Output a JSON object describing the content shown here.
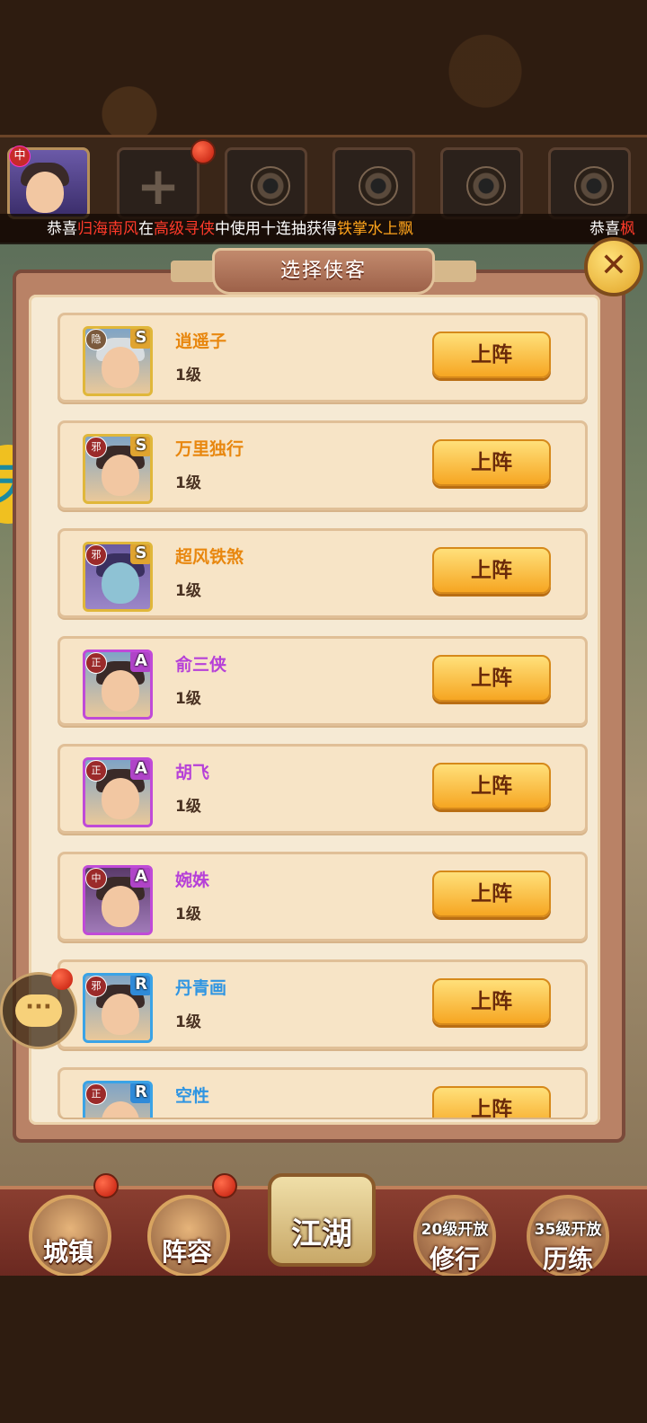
{
  "marquee": {
    "part1": "恭喜",
    "player": "归海南风",
    "part2": "在",
    "mode": "高级寻侠",
    "part3": "中使用十连抽获得",
    "item": "铁掌水上飘",
    "next_part1": "恭喜",
    "next_player": "枫"
  },
  "lineup": {
    "hero_faction": "中",
    "add_symbol": "+"
  },
  "side_badge": "天",
  "panel": {
    "title": "选择侠客",
    "close_symbol": "✕"
  },
  "heroes": [
    {
      "faction": "隐",
      "rank": "S",
      "name": "逍遥子",
      "level": "1级",
      "action": "上阵"
    },
    {
      "faction": "邪",
      "rank": "S",
      "name": "万里独行",
      "level": "1级",
      "action": "上阵"
    },
    {
      "faction": "邪",
      "rank": "S",
      "name": "超风铁煞",
      "level": "1级",
      "action": "上阵"
    },
    {
      "faction": "正",
      "rank": "A",
      "name": "俞三侠",
      "level": "1级",
      "action": "上阵"
    },
    {
      "faction": "正",
      "rank": "A",
      "name": "胡飞",
      "level": "1级",
      "action": "上阵"
    },
    {
      "faction": "中",
      "rank": "A",
      "name": "婉姝",
      "level": "1级",
      "action": "上阵"
    },
    {
      "faction": "邪",
      "rank": "R",
      "name": "丹青画",
      "level": "1级",
      "action": "上阵"
    },
    {
      "faction": "正",
      "rank": "R",
      "name": "空性",
      "level": "",
      "action": "上阵"
    }
  ],
  "chat": {
    "symbol": "···"
  },
  "nav": {
    "town": "城镇",
    "lineup": "阵容",
    "jianghu": "江湖",
    "cultivate_lock": "20级开放",
    "cultivate": "修行",
    "train_lock": "35级开放",
    "train": "历练"
  }
}
